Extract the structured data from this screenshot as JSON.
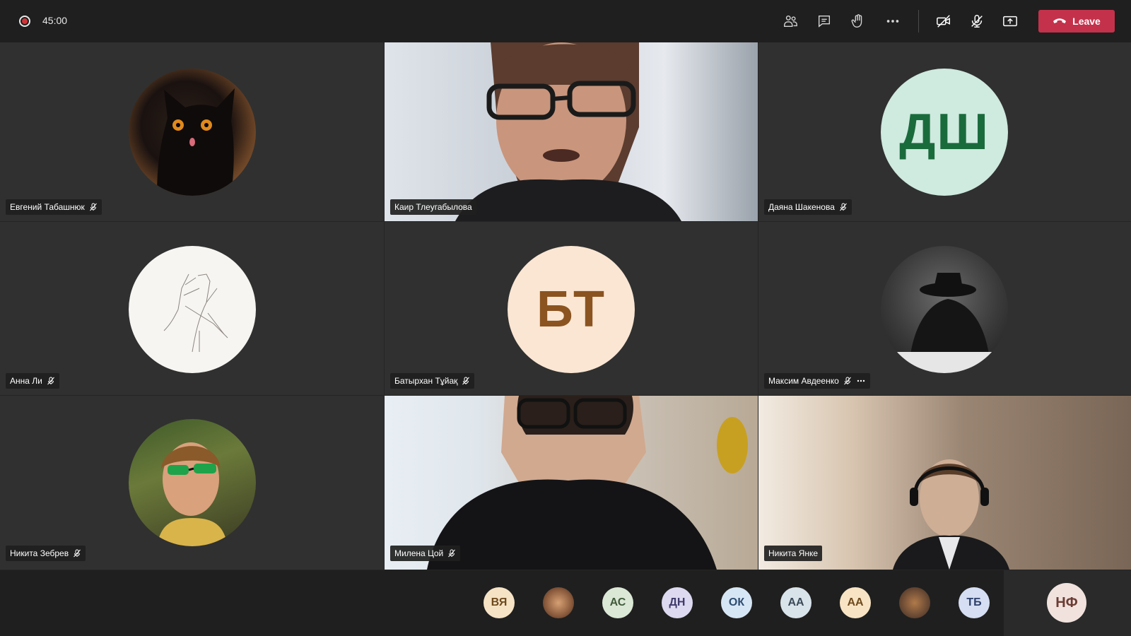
{
  "topbar": {
    "timer": "45:00",
    "leave_label": "Leave",
    "icons": [
      "participants-icon",
      "chat-icon",
      "raise-hand-icon",
      "more-icon",
      "camera-off-icon",
      "mic-off-icon",
      "share-icon"
    ]
  },
  "tiles": [
    {
      "name": "Евгений Табашнюк",
      "type": "photo-avatar",
      "muted": true
    },
    {
      "name": "Каир Тлеугабылова",
      "type": "video",
      "muted": false
    },
    {
      "name": "Даяна Шакенова",
      "type": "initials",
      "initials": "ДШ",
      "bg": "#cfeadf",
      "fg": "#1a6b3c",
      "muted": true
    },
    {
      "name": "Анна Ли",
      "type": "photo-avatar",
      "muted": true
    },
    {
      "name": "Батырхан Тұйақ",
      "type": "initials",
      "initials": "БТ",
      "bg": "#fbe6d3",
      "fg": "#8a5320",
      "muted": true
    },
    {
      "name": "Максим Авдеенко",
      "type": "photo-avatar",
      "muted": true,
      "more": true
    },
    {
      "name": "Никита Зебрев",
      "type": "photo-avatar",
      "muted": true
    },
    {
      "name": "Милена Цой",
      "type": "video",
      "muted": true
    },
    {
      "name": "Никита Янке",
      "type": "video",
      "muted": false
    }
  ],
  "bottom_participants": [
    {
      "initials": "ВЯ",
      "bg": "#f6e3c6",
      "fg": "#6e4a1d"
    },
    {
      "initials": "",
      "photo": true,
      "bg": "#8a5a3c"
    },
    {
      "initials": "АС",
      "bg": "#dbe8d6",
      "fg": "#3f5a3a"
    },
    {
      "initials": "ДН",
      "bg": "#ddd9f0",
      "fg": "#3f3a6b"
    },
    {
      "initials": "ОК",
      "bg": "#d7e6f5",
      "fg": "#2d4d70"
    },
    {
      "initials": "АА",
      "bg": "#d9e3ea",
      "fg": "#3a4a58"
    },
    {
      "initials": "АА",
      "bg": "#f8e4c4",
      "fg": "#6e4a1d"
    },
    {
      "initials": "",
      "photo": true,
      "bg": "#7a5a44"
    },
    {
      "initials": "ТБ",
      "bg": "#d5def2",
      "fg": "#2d3f6b"
    }
  ],
  "self": {
    "initials": "НФ",
    "bg": "#f1e2de",
    "fg": "#6b3c33"
  }
}
